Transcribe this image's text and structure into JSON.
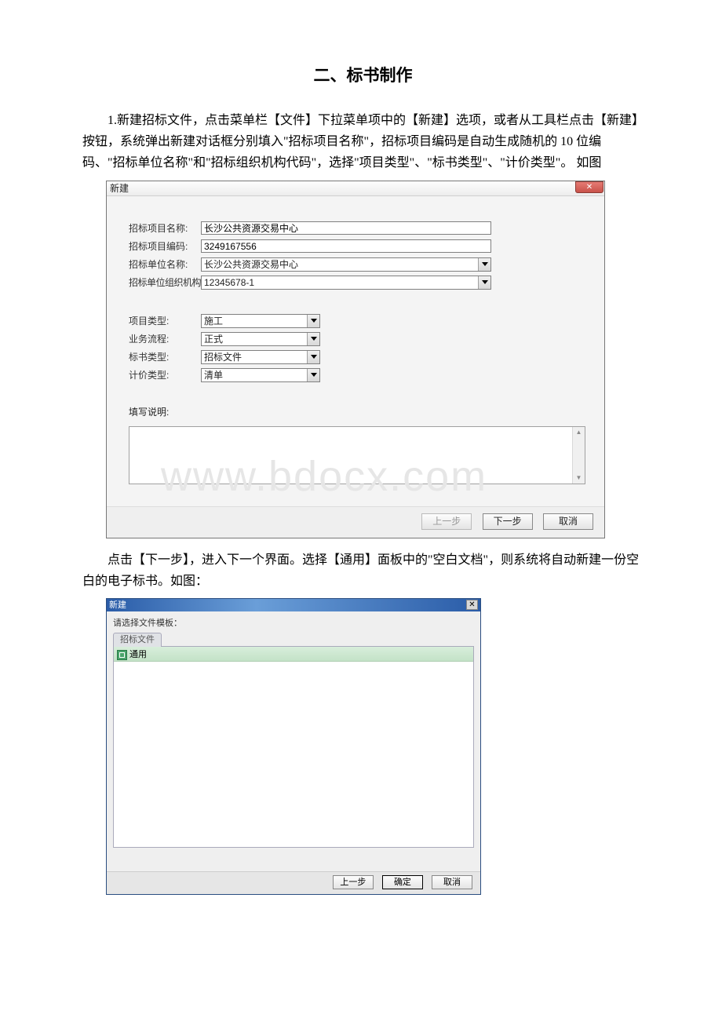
{
  "heading": "二、标书制作",
  "paragraph1": "1.新建招标文件，点击菜单栏【文件】下拉菜单项中的【新建】选项，或者从工具栏点击【新建】按钮，系统弹出新建对话框分别填入\"招标项目名称\"，招标项目编码是自动生成随机的 10 位编码、\"招标单位名称\"和\"招标组织机构代码\"，选择\"项目类型\"、\"标书类型\"、\"计价类型\"。 如图",
  "paragraph2": "点击【下一步】，进入下一个界面。选择【通用】面板中的\"空白文档\"，则系统将自动新建一份空白的电子标书。如图：",
  "watermark": "www.bdocx.com",
  "dialog1": {
    "title": "新建",
    "close": "✕",
    "labels": {
      "proj_name": "招标项目名称:",
      "proj_code": "招标项目编码:",
      "unit_name": "招标单位名称:",
      "unit_org": "招标单位组织机构",
      "proj_type": "项目类型:",
      "biz_flow": "业务流程:",
      "doc_type": "标书类型:",
      "price_type": "计价类型:",
      "notes": "填写说明:"
    },
    "values": {
      "proj_name": "长沙公共资源交易中心",
      "proj_code": "3249167556",
      "unit_name": "长沙公共资源交易中心",
      "unit_org": "12345678-1",
      "proj_type": "施工",
      "biz_flow": "正式",
      "doc_type": "招标文件",
      "price_type": "清单",
      "notes": ""
    },
    "buttons": {
      "prev": "上一步",
      "next": "下一步",
      "cancel": "取消"
    }
  },
  "dialog2": {
    "title": "新建",
    "close": "✕",
    "tmpl_label": "请选择文件模板：",
    "tabs": {
      "inactive": "招标文件"
    },
    "item": "通用",
    "buttons": {
      "prev": "上一步",
      "ok": "确定",
      "cancel": "取消"
    }
  }
}
